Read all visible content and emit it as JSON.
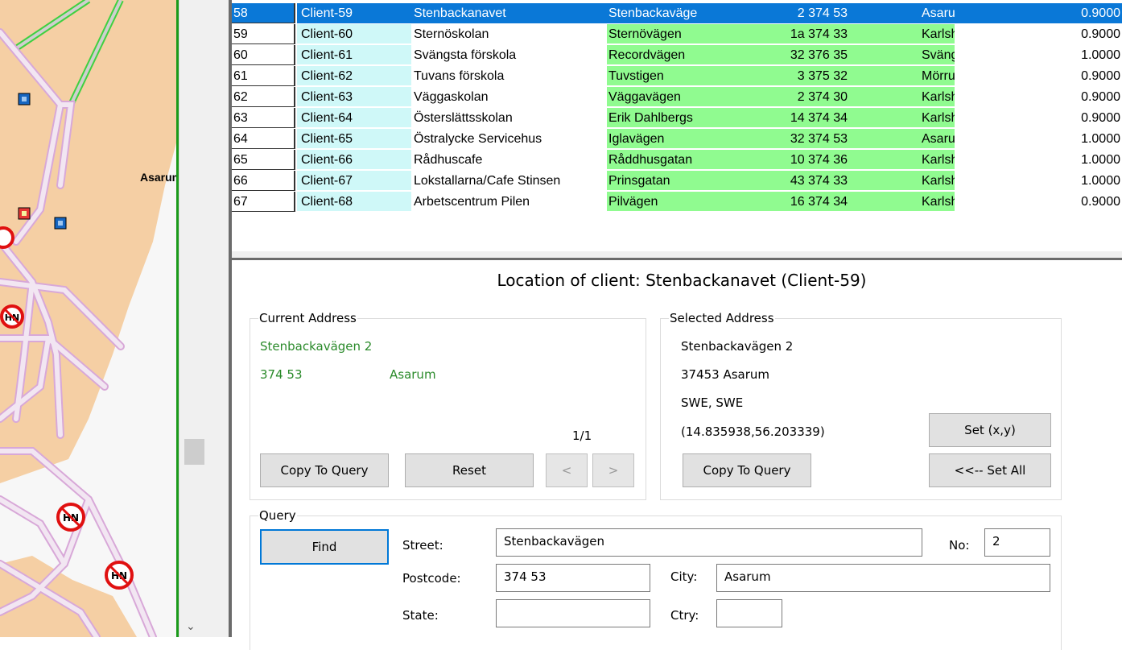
{
  "map": {
    "place_label": "Asarum"
  },
  "grid": {
    "rows": [
      {
        "idx": "58",
        "client": "Client-59",
        "name": "Stenbackanavet",
        "street": "Stenbackaväge",
        "number_postcode": "2 374 53",
        "city": "Asarum",
        "value": "0.9000",
        "selected": true
      },
      {
        "idx": "59",
        "client": "Client-60",
        "name": "Sternöskolan",
        "street": "Sternövägen",
        "number_postcode": "1a 374 33",
        "city": "Karlshamn",
        "value": "0.9000"
      },
      {
        "idx": "60",
        "client": "Client-61",
        "name": "Svängsta förskola",
        "street": "Recordvägen",
        "number_postcode": "32 376 35",
        "city": "Svängsta",
        "value": "1.0000"
      },
      {
        "idx": "61",
        "client": "Client-62",
        "name": "Tuvans förskola",
        "street": "Tuvstigen",
        "number_postcode": "3 375 32",
        "city": "Mörrum",
        "value": "0.9000"
      },
      {
        "idx": "62",
        "client": "Client-63",
        "name": "Väggaskolan",
        "street": "Väggavägen",
        "number_postcode": "2 374 30",
        "city": "Karlshamn",
        "value": "0.9000"
      },
      {
        "idx": "63",
        "client": "Client-64",
        "name": "Österslättsskolan",
        "street": "Erik Dahlbergs",
        "number_postcode": "14 374 34",
        "city": "Karlshamn",
        "value": "0.9000"
      },
      {
        "idx": "64",
        "client": "Client-65",
        "name": "Östralycke Servicehus",
        "street": "Iglavägen",
        "number_postcode": "32 374 53",
        "city": "Asarum",
        "value": "1.0000"
      },
      {
        "idx": "65",
        "client": "Client-66",
        "name": "Rådhuscafe",
        "street": "Råddhusgatan",
        "number_postcode": "10 374 36",
        "city": "Karlshamn",
        "value": "1.0000"
      },
      {
        "idx": "66",
        "client": "Client-67",
        "name": "Lokstallarna/Cafe Stinsen",
        "street": "Prinsgatan",
        "number_postcode": "43 374 33",
        "city": "Karlshamn",
        "value": "1.0000"
      },
      {
        "idx": "67",
        "client": "Client-68",
        "name": "Arbetscentrum Pilen",
        "street": "Pilvägen",
        "number_postcode": "16 374 34",
        "city": "Karlshamn",
        "value": "0.9000"
      }
    ]
  },
  "location": {
    "title": "Location of client: Stenbackanavet (Client-59)",
    "current": {
      "legend": "Current Address",
      "street": "Stenbackavägen  2",
      "postcode": "374 53",
      "city": "Asarum",
      "pager": "1/1",
      "copy_label": "Copy To Query",
      "reset_label": "Reset",
      "prev_label": "<",
      "next_label": ">"
    },
    "selected": {
      "legend": "Selected Address",
      "street": "Stenbackavägen  2",
      "postcode_city": "37453  Asarum",
      "country": "SWE, SWE",
      "coords": "(14.835938,56.203339)",
      "set_xy_label": "Set (x,y)",
      "copy_label": "Copy To Query",
      "set_all_label": "<<-- Set All"
    },
    "query": {
      "legend": "Query",
      "find_label": "Find",
      "street_label": "Street:",
      "street_value": "Stenbackavägen",
      "no_label": "No:",
      "no_value": "2",
      "postcode_label": "Postcode:",
      "postcode_value": "374 53",
      "city_label": "City:",
      "city_value": "Asarum",
      "state_label": "State:",
      "state_value": "",
      "ctry_label": "Ctry:",
      "ctry_value": ""
    }
  },
  "colors": {
    "selection": "#0a78d7",
    "client_col": "#cff8f8",
    "address_cols": "#90fb90",
    "green_text": "#2a8a2a",
    "map_land": "#f5cfa4",
    "road": "#e7c9e7"
  }
}
